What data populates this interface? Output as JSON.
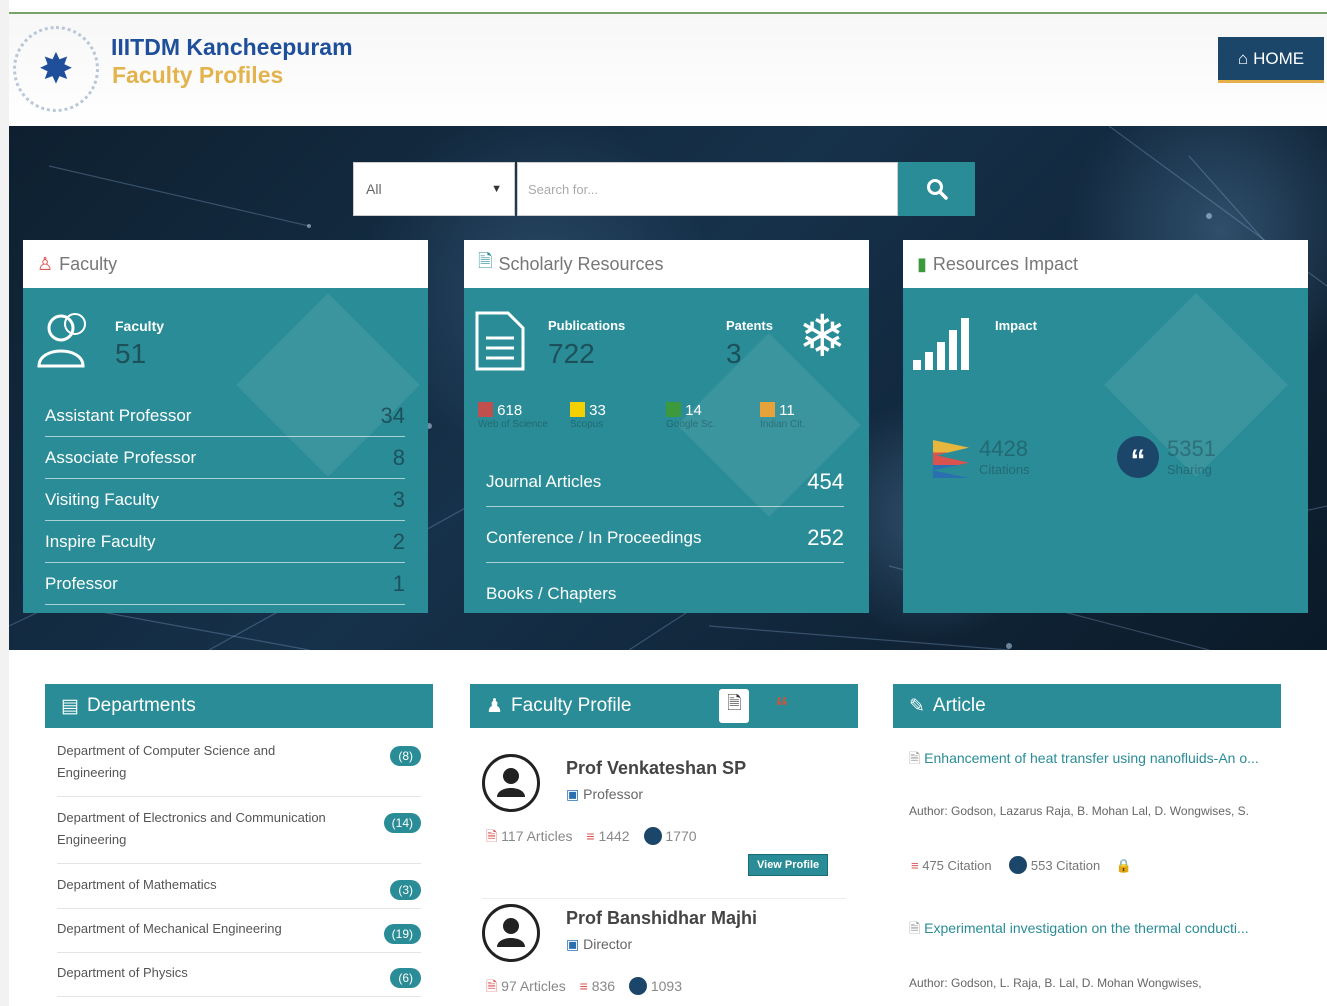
{
  "header": {
    "brand_line1": "IIITDM Kancheepuram",
    "brand_line2": "Faculty Profiles",
    "home_label": "HOME"
  },
  "search": {
    "select_value": "All",
    "placeholder": "Search for..."
  },
  "faculty_card": {
    "title": "Faculty",
    "stat_label": "Faculty",
    "stat_value": "51",
    "rows": [
      {
        "label": "Assistant Professor",
        "value": "34"
      },
      {
        "label": "Associate Professor",
        "value": "8"
      },
      {
        "label": "Visiting Faculty",
        "value": "3"
      },
      {
        "label": "Inspire Faculty",
        "value": "2"
      },
      {
        "label": "Professor",
        "value": "1"
      }
    ]
  },
  "scholarly_card": {
    "title": "Scholarly Resources",
    "publications_label": "Publications",
    "publications_value": "722",
    "patents_label": "Patents",
    "patents_value": "3",
    "indexes": [
      {
        "value": "618",
        "label": "Web of Science",
        "color": "#c0504d"
      },
      {
        "value": "33",
        "label": "Scopus",
        "color": "#f5d000"
      },
      {
        "value": "14",
        "label": "Google Sc.",
        "color": "#3c9a3c"
      },
      {
        "value": "11",
        "label": "Indian Cit.",
        "color": "#e8a23a"
      }
    ],
    "rows": [
      {
        "label": "Journal Articles",
        "value": "454"
      },
      {
        "label": "Conference / In Proceedings",
        "value": "252"
      },
      {
        "label": "Books / Chapters",
        "value": ""
      }
    ]
  },
  "impact_card": {
    "title": "Resources Impact",
    "impact_label": "Impact",
    "citations_value": "4428",
    "citations_label": "Citations",
    "sharing_value": "5351",
    "sharing_label": "Sharing"
  },
  "departments": {
    "title": "Departments",
    "items": [
      {
        "name": "Department of Computer Science and Engineering",
        "count": "(8)"
      },
      {
        "name": "Department of Electronics and Communication Engineering",
        "count": "(14)"
      },
      {
        "name": "Department of Mathematics",
        "count": "(3)"
      },
      {
        "name": "Department of Mechanical Engineering",
        "count": "(19)"
      },
      {
        "name": "Department of Physics",
        "count": "(6)"
      }
    ]
  },
  "faculty_profile": {
    "title": "Faculty Profile",
    "items": [
      {
        "name": "Prof Venkateshan SP",
        "role": "Professor",
        "articles": "117 Articles",
        "citations": "1442",
        "sharing": "1770",
        "view_label": "View Profile"
      },
      {
        "name": "Prof Banshidhar Majhi",
        "role": "Director",
        "articles": "97 Articles",
        "citations": "836",
        "sharing": "1093"
      }
    ]
  },
  "article_panel": {
    "title": "Article",
    "items": [
      {
        "title": "Enhancement of heat transfer using nanofluids-An o...",
        "author": "Author: Godson, Lazarus Raja, B. Mohan Lal, D. Wongwises, S.",
        "citation": "475 Citation",
        "sharing": "553 Citation"
      },
      {
        "title": "Experimental investigation on the thermal conducti...",
        "author": "Author: Godson, L. Raja, B. Lal, D. Mohan Wongwises,"
      }
    ]
  },
  "colors": {
    "accent": "#2a8c97",
    "brand_blue": "#1f4f9a",
    "brand_gold": "#e3b34e",
    "home_button": "#1b4669"
  }
}
